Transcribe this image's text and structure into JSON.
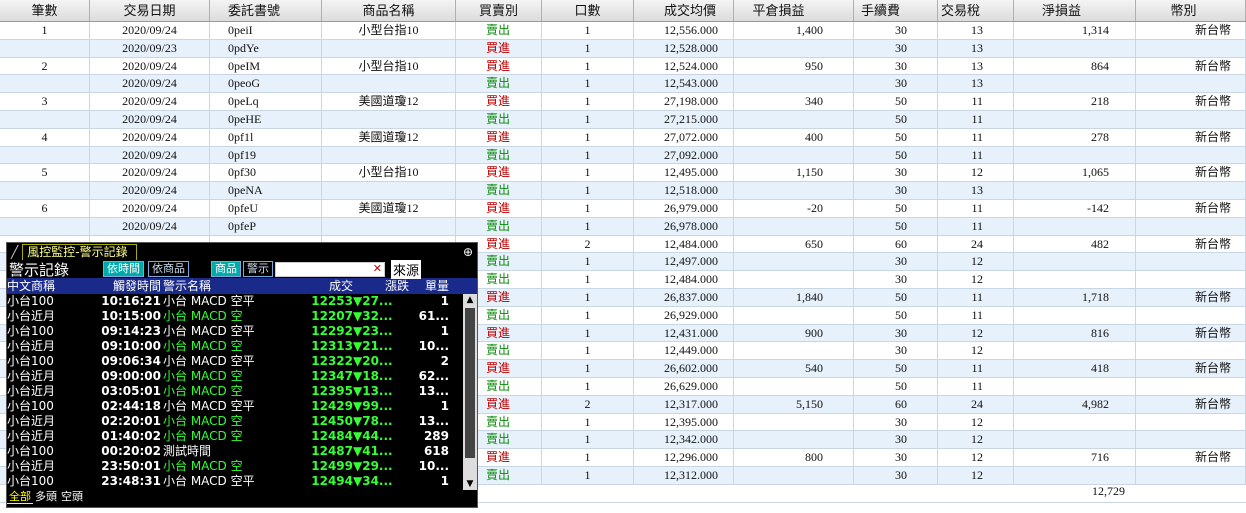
{
  "table": {
    "headers": [
      "筆數",
      "交易日期",
      "委託書號",
      "商品名稱",
      "買賣別",
      "口數",
      "成交均價",
      "平倉損益",
      "手續費",
      "交易稅",
      "淨損益",
      "幣別"
    ],
    "rows": [
      [
        "1",
        "2020/09/24",
        "0peiI",
        "小型台指10",
        "賣出",
        "1",
        "12,556.000",
        "1,400",
        "30",
        "13",
        "1,314",
        "新台幣"
      ],
      [
        "",
        "2020/09/23",
        "0pdYe",
        "",
        "買進",
        "1",
        "12,528.000",
        "",
        "30",
        "13",
        "",
        ""
      ],
      [
        "2",
        "2020/09/24",
        "0peIM",
        "小型台指10",
        "買進",
        "1",
        "12,524.000",
        "950",
        "30",
        "13",
        "864",
        "新台幣"
      ],
      [
        "",
        "2020/09/24",
        "0peoG",
        "",
        "賣出",
        "1",
        "12,543.000",
        "",
        "30",
        "13",
        "",
        ""
      ],
      [
        "3",
        "2020/09/24",
        "0peLq",
        "美國道瓊12",
        "買進",
        "1",
        "27,198.000",
        "340",
        "50",
        "11",
        "218",
        "新台幣"
      ],
      [
        "",
        "2020/09/24",
        "0peHE",
        "",
        "賣出",
        "1",
        "27,215.000",
        "",
        "50",
        "11",
        "",
        ""
      ],
      [
        "4",
        "2020/09/24",
        "0pf1l",
        "美國道瓊12",
        "買進",
        "1",
        "27,072.000",
        "400",
        "50",
        "11",
        "278",
        "新台幣"
      ],
      [
        "",
        "2020/09/24",
        "0pf19",
        "",
        "賣出",
        "1",
        "27,092.000",
        "",
        "50",
        "11",
        "",
        ""
      ],
      [
        "5",
        "2020/09/24",
        "0pf30",
        "小型台指10",
        "買進",
        "1",
        "12,495.000",
        "1,150",
        "30",
        "12",
        "1,065",
        "新台幣"
      ],
      [
        "",
        "2020/09/24",
        "0peNA",
        "",
        "賣出",
        "1",
        "12,518.000",
        "",
        "30",
        "13",
        "",
        ""
      ],
      [
        "6",
        "2020/09/24",
        "0pfeU",
        "美國道瓊12",
        "買進",
        "1",
        "26,979.000",
        "-20",
        "50",
        "11",
        "-142",
        "新台幣"
      ],
      [
        "",
        "2020/09/24",
        "0pfeP",
        "",
        "賣出",
        "1",
        "26,978.000",
        "",
        "50",
        "11",
        "",
        ""
      ],
      [
        "",
        "",
        "",
        "",
        "買進",
        "2",
        "12,484.000",
        "650",
        "60",
        "24",
        "482",
        "新台幣"
      ],
      [
        "",
        "",
        "",
        "",
        "賣出",
        "1",
        "12,497.000",
        "",
        "30",
        "12",
        "",
        ""
      ],
      [
        "",
        "",
        "",
        "",
        "賣出",
        "1",
        "12,484.000",
        "",
        "30",
        "12",
        "",
        ""
      ],
      [
        "",
        "",
        "",
        "",
        "買進",
        "1",
        "26,837.000",
        "1,840",
        "50",
        "11",
        "1,718",
        "新台幣"
      ],
      [
        "",
        "",
        "",
        "",
        "賣出",
        "1",
        "26,929.000",
        "",
        "50",
        "11",
        "",
        ""
      ],
      [
        "",
        "",
        "",
        "",
        "買進",
        "1",
        "12,431.000",
        "900",
        "30",
        "12",
        "816",
        "新台幣"
      ],
      [
        "",
        "",
        "",
        "",
        "賣出",
        "1",
        "12,449.000",
        "",
        "30",
        "12",
        "",
        ""
      ],
      [
        "",
        "",
        "",
        "",
        "買進",
        "1",
        "26,602.000",
        "540",
        "50",
        "11",
        "418",
        "新台幣"
      ],
      [
        "",
        "",
        "",
        "",
        "賣出",
        "1",
        "26,629.000",
        "",
        "50",
        "11",
        "",
        ""
      ],
      [
        "",
        "",
        "",
        "",
        "買進",
        "2",
        "12,317.000",
        "5,150",
        "60",
        "24",
        "4,982",
        "新台幣"
      ],
      [
        "",
        "",
        "",
        "",
        "賣出",
        "1",
        "12,395.000",
        "",
        "30",
        "12",
        "",
        ""
      ],
      [
        "",
        "",
        "",
        "",
        "賣出",
        "1",
        "12,342.000",
        "",
        "30",
        "12",
        "",
        ""
      ],
      [
        "",
        "",
        "",
        "",
        "買進",
        "1",
        "12,296.000",
        "800",
        "30",
        "12",
        "716",
        "新台幣"
      ],
      [
        "",
        "",
        "",
        "",
        "賣出",
        "1",
        "12,312.000",
        "",
        "30",
        "12",
        "",
        ""
      ]
    ],
    "total_net": "12,729"
  },
  "alert_window": {
    "tab_title": "風控監控-警示記錄",
    "section_title": "警示記錄",
    "btn_by_time": "依時間",
    "btn_by_product": "依商品",
    "product_label": "商品",
    "warn_label": "警示",
    "source_btn": "來源",
    "columns": [
      "中文商稱",
      "觸發時間",
      "警示名稱",
      "成交",
      "漲跌",
      "單量"
    ],
    "rows": [
      {
        "name": "小台100",
        "time": "10:16:21",
        "alert": "小台 MACD 空平",
        "alert_color": "#ffffff",
        "price": "12253",
        "chg": "▼27...",
        "qty": "1"
      },
      {
        "name": "小台近月",
        "time": "10:15:00",
        "alert": "小台 MACD 空",
        "alert_color": "#33ff33",
        "price": "12207",
        "chg": "▼32...",
        "qty": "61..."
      },
      {
        "name": "小台100",
        "time": "09:14:23",
        "alert": "小台 MACD 空平",
        "alert_color": "#ffffff",
        "price": "12292",
        "chg": "▼23...",
        "qty": "1"
      },
      {
        "name": "小台近月",
        "time": "09:10:00",
        "alert": "小台 MACD 空",
        "alert_color": "#33ff33",
        "price": "12313",
        "chg": "▼21...",
        "qty": "10..."
      },
      {
        "name": "小台100",
        "time": "09:06:34",
        "alert": "小台 MACD 空平",
        "alert_color": "#ffffff",
        "price": "12322",
        "chg": "▼20...",
        "qty": "2"
      },
      {
        "name": "小台近月",
        "time": "09:00:00",
        "alert": "小台 MACD 空",
        "alert_color": "#33ff33",
        "price": "12347",
        "chg": "▼18...",
        "qty": "62..."
      },
      {
        "name": "小台近月",
        "time": "03:05:01",
        "alert": "小台 MACD 空",
        "alert_color": "#33ff33",
        "price": "12395",
        "chg": "▼13...",
        "qty": "13..."
      },
      {
        "name": "小台100",
        "time": "02:44:18",
        "alert": "小台 MACD 空平",
        "alert_color": "#ffffff",
        "price": "12429",
        "chg": "▼99...",
        "qty": "1"
      },
      {
        "name": "小台近月",
        "time": "02:20:01",
        "alert": "小台 MACD 空",
        "alert_color": "#33ff33",
        "price": "12450",
        "chg": "▼78...",
        "qty": "13..."
      },
      {
        "name": "小台近月",
        "time": "01:40:02",
        "alert": "小台 MACD 空",
        "alert_color": "#33ff33",
        "price": "12484",
        "chg": "▼44...",
        "qty": "289"
      },
      {
        "name": "小台100",
        "time": "00:20:02",
        "alert": "測試時間",
        "alert_color": "#ffffff",
        "price": "12487",
        "chg": "▼41...",
        "qty": "618"
      },
      {
        "name": "小台近月",
        "time": "23:50:01",
        "alert": "小台 MACD 空",
        "alert_color": "#33ff33",
        "price": "12499",
        "chg": "▼29...",
        "qty": "10..."
      },
      {
        "name": "小台100",
        "time": "23:48:31",
        "alert": "小台 MACD 空平",
        "alert_color": "#ffffff",
        "price": "12494",
        "chg": "▼34...",
        "qty": "1"
      }
    ],
    "footer_tabs": [
      "全部",
      "多頭",
      "空頭"
    ]
  },
  "colors": {
    "buy": "#c00000",
    "sell": "#0a8a0a",
    "row_alt": "#e6f1fb",
    "header_blue": "#1a2a8a"
  }
}
